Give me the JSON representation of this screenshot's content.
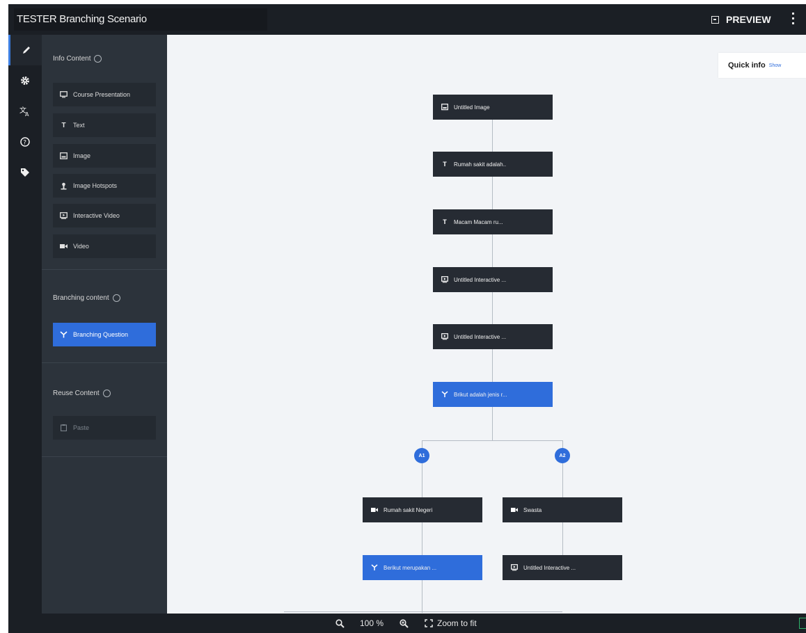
{
  "header": {
    "title": "TESTER Branching Scenario",
    "preview_label": "PREVIEW"
  },
  "rail": {
    "items": [
      {
        "name": "edit-icon",
        "active": true
      },
      {
        "name": "gear-icon",
        "active": false
      },
      {
        "name": "translate-icon",
        "active": false
      },
      {
        "name": "help-icon",
        "active": false
      },
      {
        "name": "tag-icon",
        "active": false
      }
    ]
  },
  "panel": {
    "info_content_title": "Info Content",
    "info_items": [
      {
        "icon": "presentation-icon",
        "label": "Course Presentation"
      },
      {
        "icon": "text-icon",
        "label": "Text"
      },
      {
        "icon": "image-icon",
        "label": "Image"
      },
      {
        "icon": "hotspot-icon",
        "label": "Image Hotspots"
      },
      {
        "icon": "interactive-video-icon",
        "label": "Interactive Video"
      },
      {
        "icon": "video-icon",
        "label": "Video"
      }
    ],
    "branching_content_title": "Branching content",
    "branching_question_label": "Branching Question",
    "reuse_content_title": "Reuse Content",
    "paste_label": "Paste"
  },
  "canvas": {
    "quick_info_label": "Quick info",
    "quick_info_toggle": "Show",
    "nodes": [
      {
        "icon": "image-icon",
        "label": "Untitled Image",
        "blue": false
      },
      {
        "icon": "text-icon",
        "label": "Rumah sakit adalah..",
        "blue": false
      },
      {
        "icon": "text-icon",
        "label": "Macam Macam ru...",
        "blue": false
      },
      {
        "icon": "interactive-video-icon",
        "label": "Untitled Interactive ...",
        "blue": false
      },
      {
        "icon": "interactive-video-icon",
        "label": "Untitled Interactive ...",
        "blue": false
      },
      {
        "icon": "branching-icon",
        "label": "Brikut adalah jenis r...",
        "blue": true
      }
    ],
    "branches": [
      {
        "badge": "A1",
        "nodes": [
          {
            "icon": "video-icon",
            "label": "Rumah sakit Negeri",
            "blue": false
          },
          {
            "icon": "branching-icon",
            "label": "Berikut merupakan ...",
            "blue": true
          }
        ]
      },
      {
        "badge": "A2",
        "nodes": [
          {
            "icon": "video-icon",
            "label": "Swasta",
            "blue": false
          },
          {
            "icon": "interactive-video-icon",
            "label": "Untitled Interactive ...",
            "blue": false
          }
        ]
      }
    ]
  },
  "zoom": {
    "level": "100 %",
    "fit_label": "Zoom to fit"
  },
  "colors": {
    "accent": "#2f6ddb",
    "node_dark": "#262b33",
    "panel": "#2c333b",
    "canvas": "#f2f4f7"
  }
}
